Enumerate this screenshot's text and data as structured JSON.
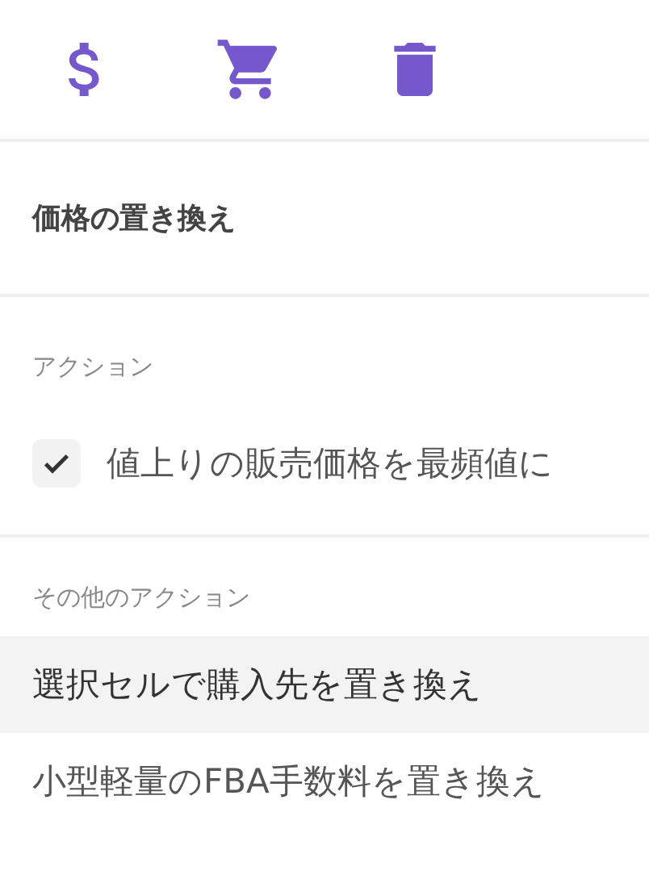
{
  "toolbar": {
    "buttons": [
      {
        "kind": "dollar"
      },
      {
        "kind": "cart"
      },
      {
        "kind": "trash"
      }
    ]
  },
  "title": "価格の置き換え",
  "actions": {
    "heading": "アクション",
    "items": [
      {
        "label": "値上りの販売価格を最頻値に",
        "checked": true
      }
    ]
  },
  "other_actions": {
    "heading": "その他のアクション",
    "items": [
      {
        "label": "選択セルで購入先を置き換え",
        "selected": true
      },
      {
        "label": "小型軽量のFBA手数料を置き換え",
        "selected": false
      }
    ]
  }
}
